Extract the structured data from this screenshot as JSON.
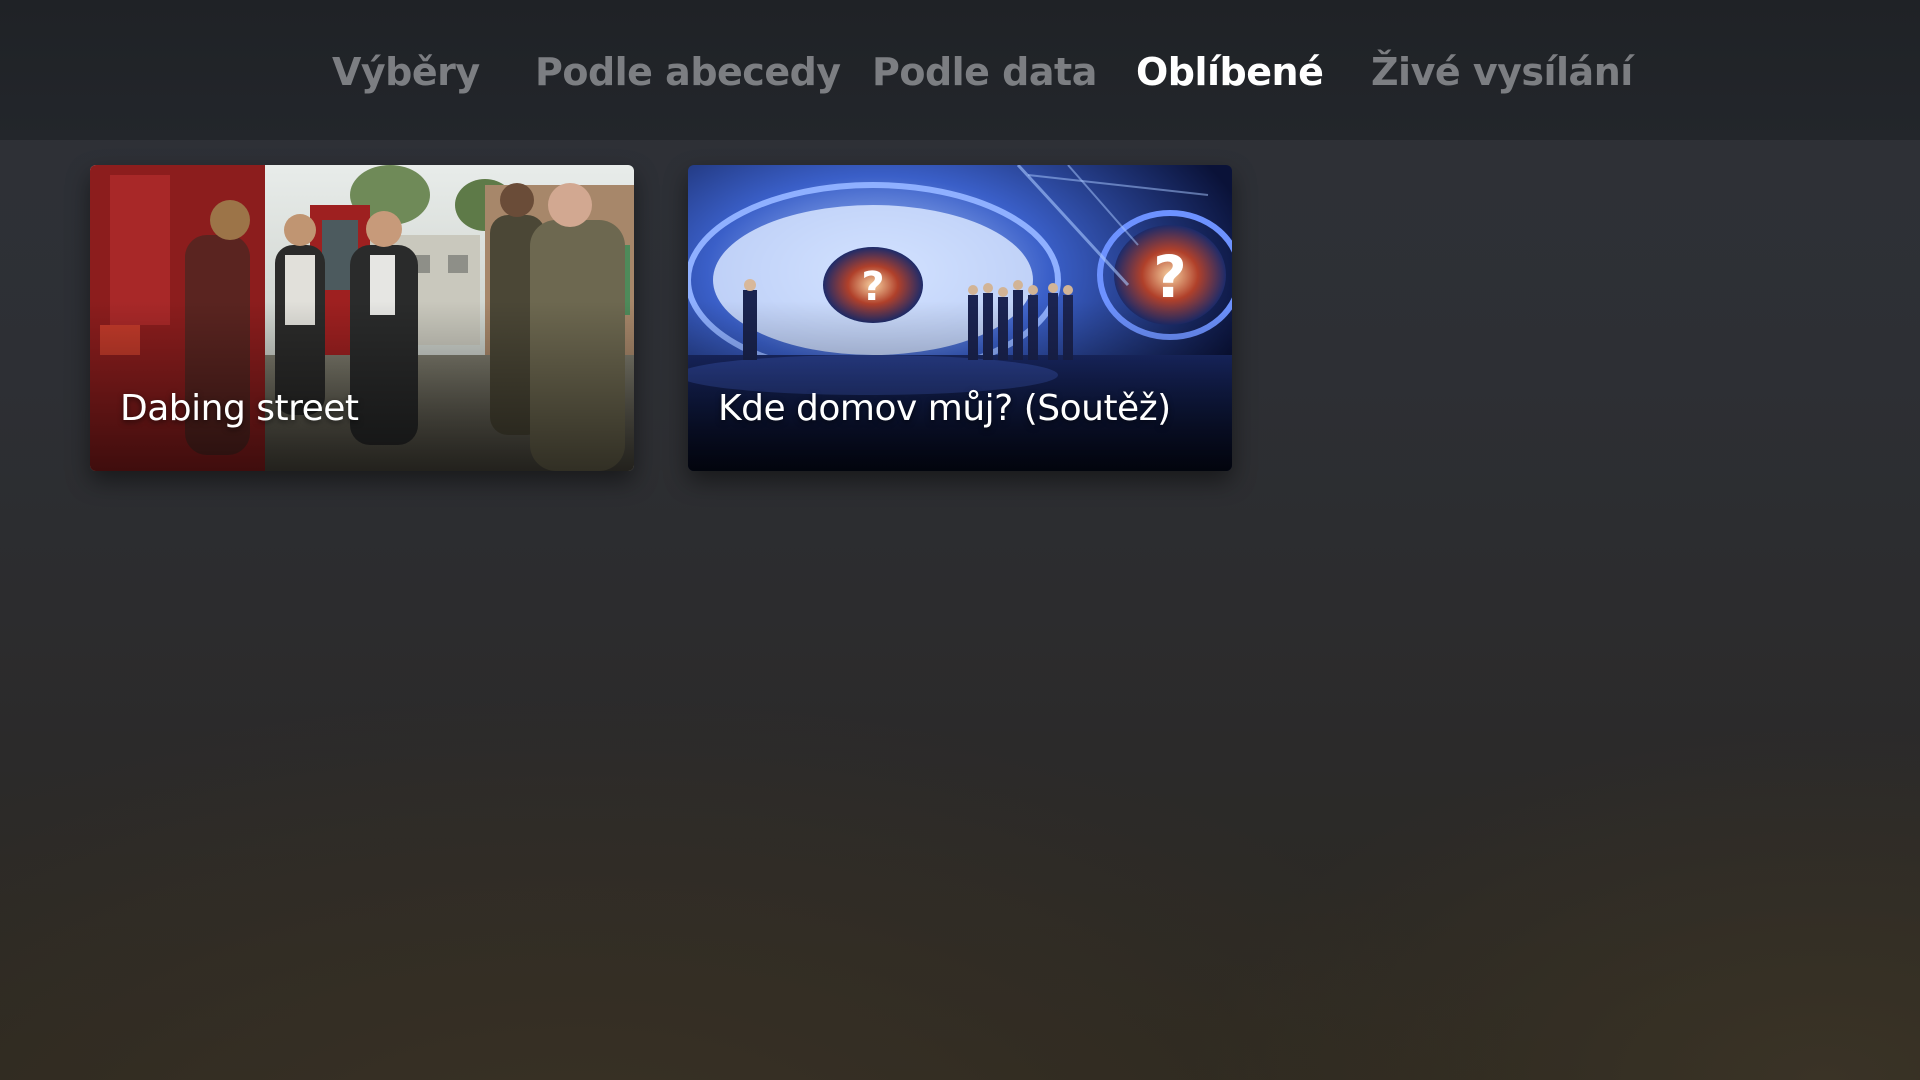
{
  "nav": {
    "tabs": [
      {
        "label": "Výběry",
        "active": false
      },
      {
        "label": "Podle abecedy",
        "active": false
      },
      {
        "label": "Podle data",
        "active": false
      },
      {
        "label": "Oblíbené",
        "active": true
      },
      {
        "label": "Živé vysílání",
        "active": false
      }
    ]
  },
  "favorites": {
    "items": [
      {
        "title": "Dabing street",
        "thumbnail": "drama-scene-red-van"
      },
      {
        "title": "Kde domov můj? (Soutěž)",
        "thumbnail": "quiz-show-studio"
      }
    ]
  },
  "colors": {
    "active_tab": "#ffffff",
    "inactive_tab": "#7c7e82",
    "top_bar": "#1f2226"
  }
}
